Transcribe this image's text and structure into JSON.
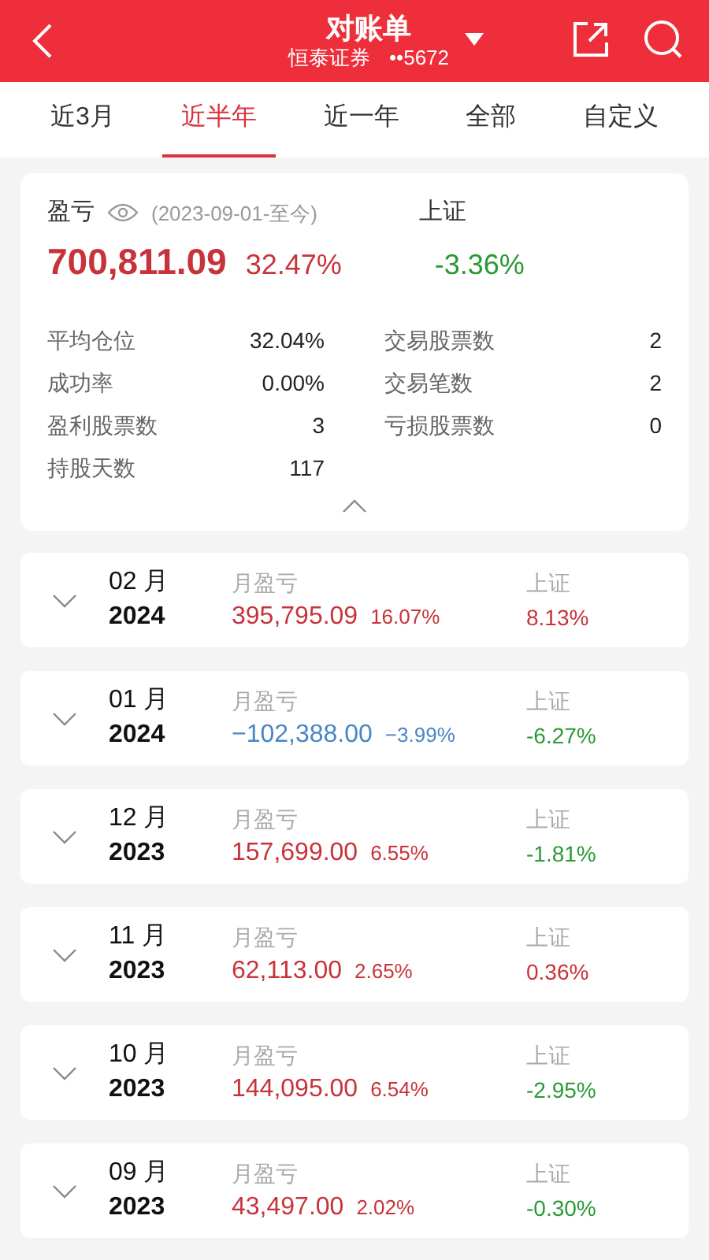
{
  "header": {
    "title": "对账单",
    "broker": "恒泰证券",
    "account": "••5672"
  },
  "tabs": [
    {
      "label": "近3月",
      "selected": false
    },
    {
      "label": "近半年",
      "selected": true
    },
    {
      "label": "近一年",
      "selected": false
    },
    {
      "label": "全部",
      "selected": false
    },
    {
      "label": "自定义",
      "selected": false
    }
  ],
  "summary": {
    "label": "盈亏",
    "period": "(2023-09-01-至今)",
    "amount": "700,811.09",
    "percent": "32.47%",
    "gain": true,
    "index_label": "上证",
    "index_change": "-3.36%",
    "index_gain": false,
    "stats": [
      {
        "label": "平均仓位",
        "value": "32.04%"
      },
      {
        "label": "交易股票数",
        "value": "2"
      },
      {
        "label": "成功率",
        "value": "0.00%"
      },
      {
        "label": "交易笔数",
        "value": "2"
      },
      {
        "label": "盈利股票数",
        "value": "3"
      },
      {
        "label": "亏损股票数",
        "value": "0"
      },
      {
        "label": "持股天数",
        "value": "117"
      }
    ],
    "expanded": true
  },
  "months": [
    {
      "month": "02 月",
      "year": "2024",
      "label": "月盈亏",
      "amount": "395,795.09",
      "percent": "16.07%",
      "gain": true,
      "index_label": "上证",
      "index_change": "8.13%",
      "index_gain": true,
      "expanded": false
    },
    {
      "month": "01 月",
      "year": "2024",
      "label": "月盈亏",
      "amount": "−102,388.00",
      "percent": "−3.99%",
      "gain": false,
      "index_label": "上证",
      "index_change": "-6.27%",
      "index_gain": false,
      "expanded": false
    },
    {
      "month": "12 月",
      "year": "2023",
      "label": "月盈亏",
      "amount": "157,699.00",
      "percent": "6.55%",
      "gain": true,
      "index_label": "上证",
      "index_change": "-1.81%",
      "index_gain": false,
      "expanded": false
    },
    {
      "month": "11 月",
      "year": "2023",
      "label": "月盈亏",
      "amount": "62,113.00",
      "percent": "2.65%",
      "gain": true,
      "index_label": "上证",
      "index_change": "0.36%",
      "index_gain": true,
      "expanded": false
    },
    {
      "month": "10 月",
      "year": "2023",
      "label": "月盈亏",
      "amount": "144,095.00",
      "percent": "6.54%",
      "gain": true,
      "index_label": "上证",
      "index_change": "-2.95%",
      "index_gain": false,
      "expanded": false
    },
    {
      "month": "09 月",
      "year": "2023",
      "label": "月盈亏",
      "amount": "43,497.00",
      "percent": "2.02%",
      "gain": true,
      "index_label": "上证",
      "index_change": "-0.30%",
      "index_gain": false,
      "expanded": false
    }
  ]
}
